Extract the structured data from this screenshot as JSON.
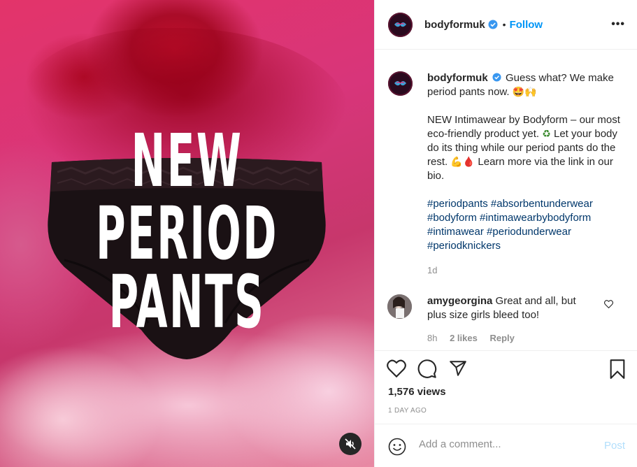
{
  "media": {
    "headline": [
      "NEW",
      "PERIOD",
      "PANTS"
    ],
    "mute_icon": "speaker-muted-icon"
  },
  "header": {
    "username": "bodyformuk",
    "separator": "•",
    "follow_label": "Follow",
    "more_icon": "more-options-icon",
    "more_label": "•••"
  },
  "caption": {
    "username": "bodyformuk",
    "line1": "Guess what? We make period pants now.",
    "line1_emoji": "🤩🙌",
    "para2": "NEW Intimawear by Bodyform – our most eco-friendly product yet.",
    "para2_emoji1": "♻",
    "para2b": "Let your body do its thing while our period pants do the rest.",
    "para2_emoji2": "💪🩸",
    "para2c": "Learn more via the link in our bio.",
    "hashtags": [
      "#periodpants",
      "#absorbentunderwear",
      "#bodyform",
      "#intimawearbybodyform",
      "#intimawear",
      "#periodunderwear",
      "#periodknickers"
    ],
    "age": "1d"
  },
  "comment": {
    "username": "amygeorgina",
    "text": "Great and all, but plus size girls bleed too!",
    "age": "8h",
    "likes": "2 likes",
    "reply": "Reply"
  },
  "actions": {
    "views": "1,576 views",
    "date": "1 DAY AGO"
  },
  "add_comment": {
    "placeholder": "Add a comment...",
    "post_label": "Post"
  },
  "colors": {
    "accent": "#0095f6",
    "hashtag": "#00376b",
    "muted": "#8e8e8e",
    "post_disabled": "#b2dffc"
  }
}
